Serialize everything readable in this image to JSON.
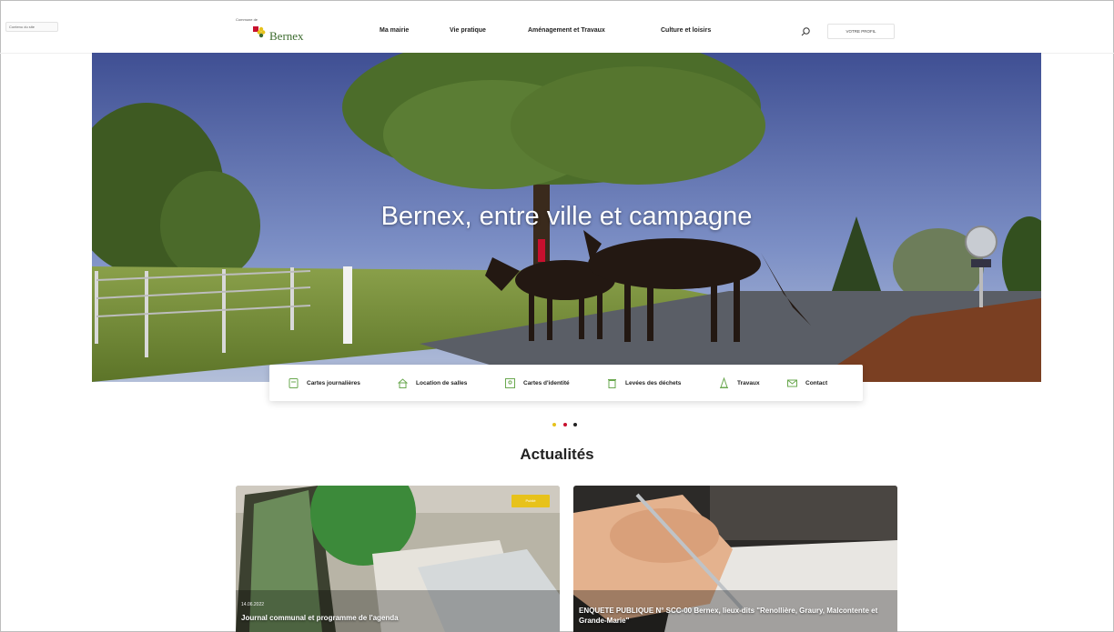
{
  "header": {
    "skip_link": "Contenu du site",
    "logo_small": "Commune de",
    "logo_name": "Bernex",
    "nav": [
      "Ma mairie",
      "Vie pratique",
      "Aménagement et Travaux",
      "Culture et loisirs"
    ],
    "profile_button": "VOTRE PROFIL"
  },
  "hero": {
    "title": "Bernex, entre ville et campagne"
  },
  "quick_links": [
    {
      "label": "Cartes journalières",
      "icon": "card-icon"
    },
    {
      "label": "Location de salles",
      "icon": "house-icon"
    },
    {
      "label": "Cartes d'identité",
      "icon": "id-card-icon"
    },
    {
      "label": "Levées des déchets",
      "icon": "trash-icon"
    },
    {
      "label": "Travaux",
      "icon": "cone-icon"
    },
    {
      "label": "Contact",
      "icon": "mail-icon"
    }
  ],
  "slider_dots": [
    "#e7c21b",
    "#c8102e",
    "#222222"
  ],
  "colors": {
    "accent_green": "#3c6b2e",
    "badge_yellow": "#e7c21b"
  },
  "news": {
    "title": "Actualités",
    "cards": [
      {
        "date": "14.06.2022",
        "title": "Journal communal et programme de l'agenda",
        "badge": "Publié"
      },
      {
        "date": "",
        "title": "ENQUETE PUBLIQUE N° SCC-00 Bernex, lieux-dits \"Renollière, Graury, Malcontente et Grande-Marie\""
      }
    ]
  }
}
